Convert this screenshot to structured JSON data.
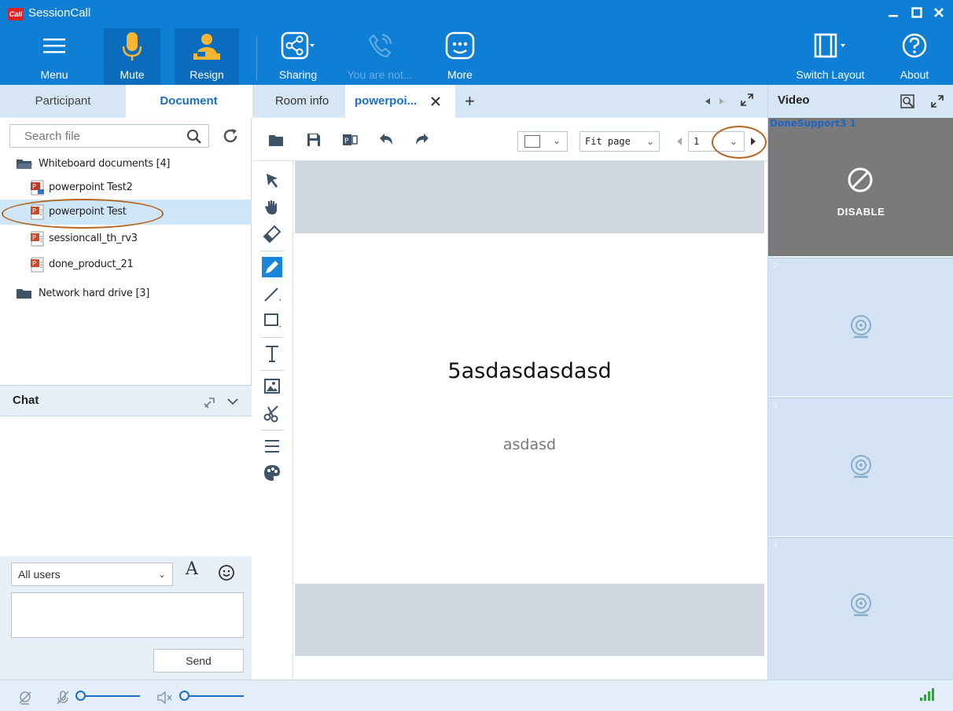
{
  "window": {
    "title": "SessionCall",
    "logo_text": "Call"
  },
  "toolbar": {
    "menu_label": "Menu",
    "mute_label": "Mute",
    "resign_label": "Resign",
    "sharing_label": "Sharing",
    "call_label": "You are not...",
    "more_label": "More",
    "switch_layout_label": "Switch Layout",
    "about_label": "About"
  },
  "left_tabs": {
    "participant": "Participant",
    "document": "Document"
  },
  "search": {
    "placeholder": "Search file"
  },
  "tree": {
    "whiteboard_folder": "Whiteboard documents [4]",
    "files": [
      "powerpoint Test2",
      "powerpoint Test",
      "sessioncall_th_rv3",
      "done_product_21"
    ],
    "network_folder": "Network hard drive [3]"
  },
  "chat": {
    "title": "Chat",
    "recipient": "All users",
    "send_label": "Send",
    "font_glyph": "A"
  },
  "doc_tabs": {
    "room_info": "Room info",
    "active_tab": "powerpoi...",
    "add": "+"
  },
  "doc_toolbar": {
    "zoom": "Fit page",
    "page": "1"
  },
  "slide": {
    "title": "5asdasdasdasd",
    "subtitle": "asdasd"
  },
  "video": {
    "title": "Video",
    "cells": [
      {
        "owner": "DoneSupport3 1",
        "status": "DISABLE"
      },
      {
        "num": "2"
      },
      {
        "num": "3"
      },
      {
        "num": "4"
      }
    ]
  },
  "colors": {
    "brand": "#0f7fd6",
    "accent": "#1c6fc0",
    "panel_bg": "#e7eff8",
    "annotation": "#b5651d"
  }
}
